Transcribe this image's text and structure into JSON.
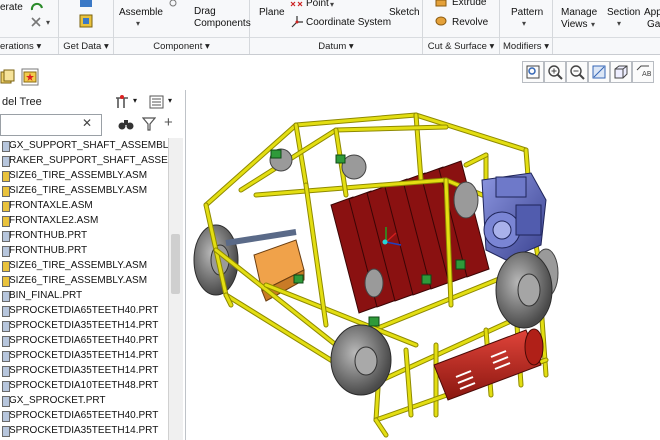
{
  "ribbon": {
    "groups": [
      {
        "label": "erations",
        "dropdown": "▾"
      },
      {
        "label": "Get Data",
        "dropdown": "▾"
      },
      {
        "label": "Component",
        "dropdown": "▾"
      },
      {
        "label": "Datum",
        "dropdown": "▾"
      },
      {
        "label": "Cut & Surface",
        "dropdown": "▾"
      },
      {
        "label": "Modifiers",
        "dropdown": "▾"
      }
    ],
    "buttons": {
      "regenerate": "erate",
      "assemble": "Assemble",
      "drag_components_1": "Drag",
      "drag_components_2": "Components",
      "plane": "Plane",
      "point": "Point",
      "coordinate_system": "Coordinate System",
      "sketch": "Sketch",
      "extrude": "Extrude",
      "revolve": "Revolve",
      "pattern": "Pattern",
      "manage_views_1": "Manage",
      "manage_views_2": "Views",
      "section": "Section",
      "appearance_1": "Appe",
      "appearance_2": "Gal"
    }
  },
  "model_tree": {
    "title": "del Tree",
    "search_value": "",
    "items": [
      "GX_SUPPORT_SHAFT_ASSEMBL",
      "RAKER_SUPPORT_SHAFT_ASSE",
      "SIZE6_TIRE_ASSEMBLY.ASM",
      "SIZE6_TIRE_ASSEMBLY.ASM",
      "FRONTAXLE.ASM",
      "FRONTAXLE2.ASM",
      "FRONTHUB.PRT",
      "FRONTHUB.PRT",
      "SIZE6_TIRE_ASSEMBLY.ASM",
      "SIZE6_TIRE_ASSEMBLY.ASM",
      "BIN_FINAL.PRT",
      "SPROCKETDIA65TEETH40.PRT",
      "SPROCKETDIA35TEETH14.PRT",
      "SPROCKETDIA65TEETH40.PRT",
      "SPROCKETDIA35TEETH14.PRT",
      "SPROCKETDIA35TEETH14.PRT",
      "SPROCKETDIA10TEETH48.PRT",
      "GX_SPROCKET.PRT",
      "SPROCKETDIA65TEETH40.PRT",
      "SPROCKETDIA35TEETH14.PRT",
      "SPROCKETDIA35TEETH14.PRT"
    ]
  },
  "colors": {
    "frame": "#e3de12",
    "frame_dark": "#8f8a00",
    "rake": "#8a1111",
    "engine": "#5b66b8",
    "tire": "#6f6f6f",
    "motor": "#c0261e"
  }
}
